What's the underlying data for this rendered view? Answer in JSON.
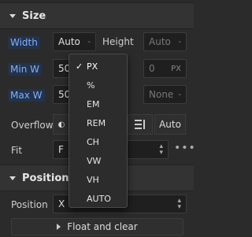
{
  "size_section": {
    "title": "Size",
    "width_label": "Width",
    "width_value": "Auto",
    "width_suffix": "-",
    "height_label": "Height",
    "height_value": "Auto",
    "height_suffix": "-",
    "min_w_label": "Min W",
    "min_w_value": "50",
    "min_h_value": "0",
    "min_h_unit": "PX",
    "max_w_label": "Max W",
    "max_w_value": "50",
    "max_h_value": "None",
    "max_h_suffix": "-"
  },
  "overflow": {
    "label": "Overflow",
    "auto_label": "Auto"
  },
  "fit": {
    "label": "Fit",
    "value": "F"
  },
  "unit_dropdown": {
    "selected": "PX",
    "check": "✓",
    "options": [
      "PX",
      "%",
      "EM",
      "REM",
      "CH",
      "VW",
      "VH",
      "AUTO"
    ]
  },
  "position_section": {
    "title": "Position",
    "position_label": "Position",
    "position_value": "X",
    "float_label": "Float and clear"
  }
}
